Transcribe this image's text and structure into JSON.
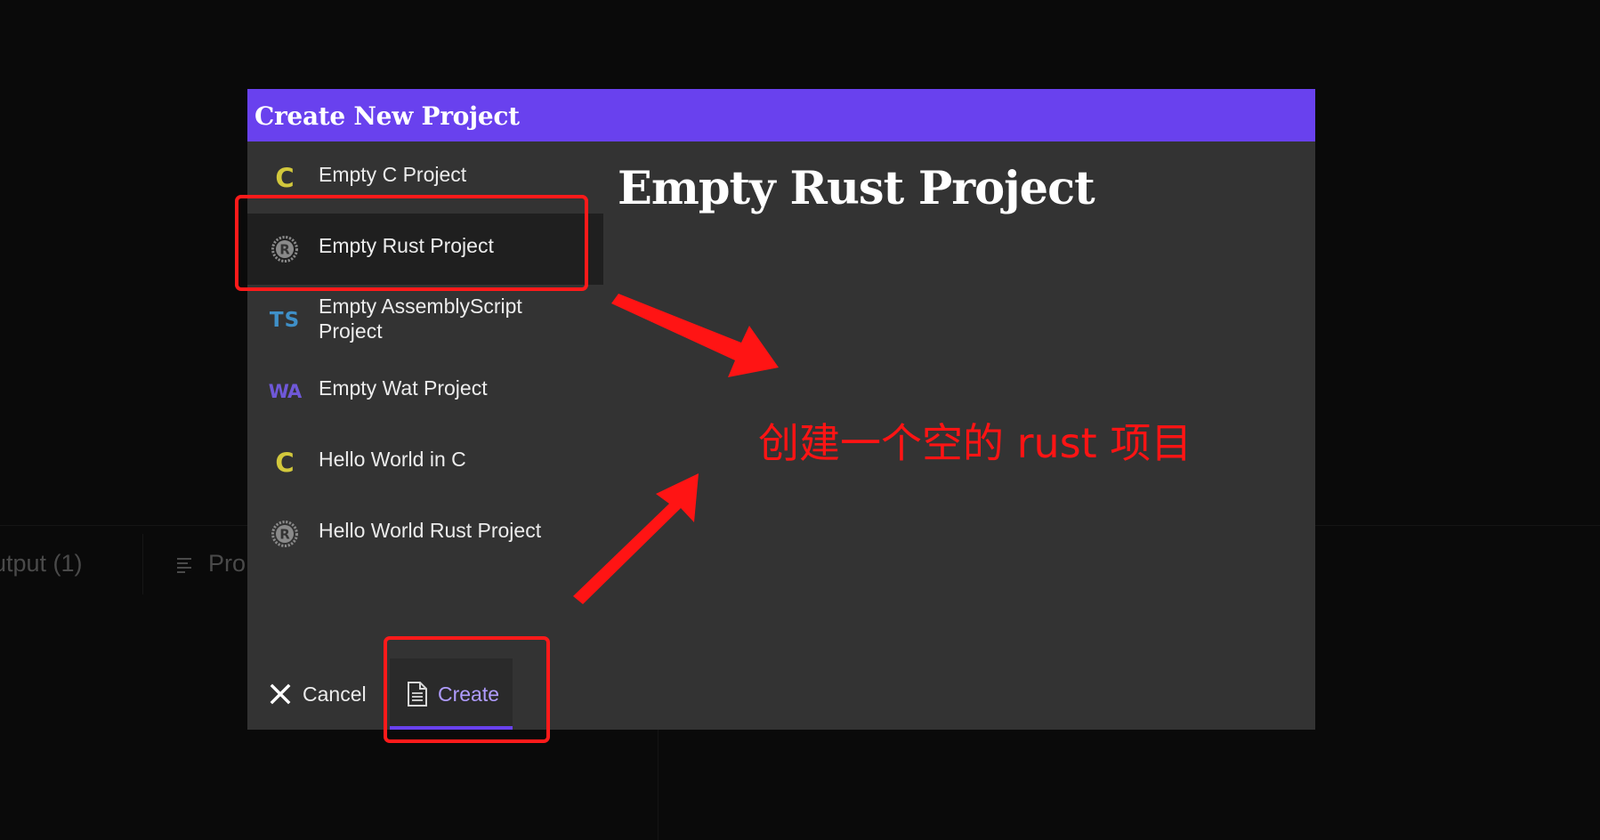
{
  "background": {
    "output_tab_label": "utput (1)",
    "problems_tab_label": "Pro",
    "problems_tab_icon": "lines-icon"
  },
  "dialog": {
    "title": "Create New Project",
    "header_color": "#6941ee",
    "templates": [
      {
        "label": "Empty C Project",
        "icon": "c-language-icon",
        "icon_text": "C",
        "selected": false
      },
      {
        "label": "Empty Rust Project",
        "icon": "rust-icon",
        "icon_text": "",
        "selected": true
      },
      {
        "label": "Empty AssemblyScript Project",
        "icon": "typescript-icon",
        "icon_text": "TS",
        "selected": false
      },
      {
        "label": "Empty Wat Project",
        "icon": "webassembly-icon",
        "icon_text": "WA",
        "selected": false
      },
      {
        "label": "Hello World in C",
        "icon": "c-language-icon",
        "icon_text": "C",
        "selected": false
      },
      {
        "label": "Hello World Rust Project",
        "icon": "rust-icon",
        "icon_text": "",
        "selected": false
      }
    ],
    "detail_title": "Empty Rust Project",
    "buttons": {
      "cancel_label": "Cancel",
      "create_label": "Create"
    },
    "accent_color": "#6941ee"
  },
  "annotation": {
    "text": "创建一个空的 rust 项目",
    "color": "#ff1414"
  }
}
